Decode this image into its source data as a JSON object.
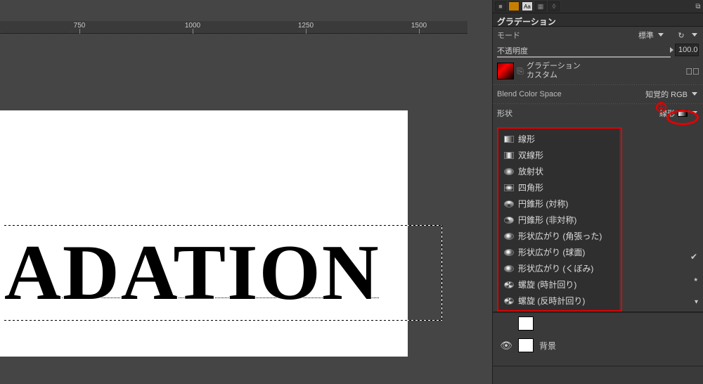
{
  "ruler": {
    "ticks": [
      "750",
      "1000",
      "1250",
      "1500"
    ]
  },
  "canvas": {
    "text": "ADATION"
  },
  "panel": {
    "title": "グラデーション",
    "mode_label": "モード",
    "mode_value": "標準",
    "opacity_label": "不透明度",
    "opacity_value": "100.0",
    "gradient_label": "グラデーション",
    "gradient_preset": "カスタム",
    "blend_label": "Blend Color Space",
    "blend_value": "知覚的 RGB",
    "shape_label": "形状",
    "shape_value": "線形",
    "annot_number": "①"
  },
  "shapes": [
    {
      "k": "linear",
      "label": "線形"
    },
    {
      "k": "bilinear",
      "label": "双線形"
    },
    {
      "k": "radial",
      "label": "放射状"
    },
    {
      "k": "square",
      "label": "四角形"
    },
    {
      "k": "cone",
      "label": "円錐形 (対称)"
    },
    {
      "k": "coneasym",
      "label": "円錐形 (非対称)"
    },
    {
      "k": "swirl",
      "label": "形状広がり (角張った)"
    },
    {
      "k": "swirl",
      "label": "形状広がり (球面)"
    },
    {
      "k": "swirl",
      "label": "形状広がり (くぼみ)"
    },
    {
      "k": "spiral",
      "label": "螺旋 (時計回り)"
    },
    {
      "k": "spiral",
      "label": "螺旋 (反時計回り)"
    }
  ],
  "layers": [
    {
      "label": "",
      "visible": false
    },
    {
      "label": "背景",
      "visible": true
    }
  ]
}
